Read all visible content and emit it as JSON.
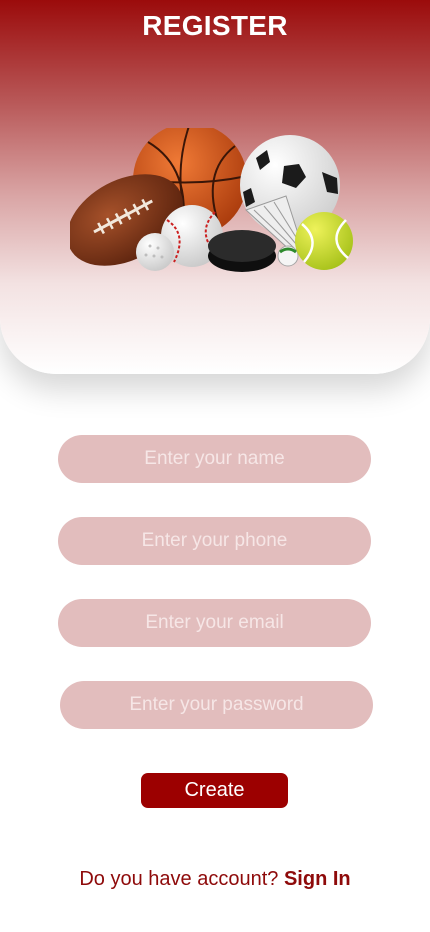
{
  "header": {
    "title": "REGISTER",
    "illustration": "sports-balls-illustration",
    "gradient_colors": [
      "#9b0b0b",
      "#ffffff"
    ]
  },
  "form": {
    "name_placeholder": "Enter your name",
    "phone_placeholder": "Enter your phone",
    "email_placeholder": "Enter your email",
    "password_placeholder": "Enter your password",
    "field_color": "#e2bdbd",
    "create_label": "Create",
    "create_color": "#9c0000"
  },
  "footer": {
    "prompt": "Do you have account?",
    "signin_label": "Sign In",
    "text_color": "#8e0a0a"
  }
}
